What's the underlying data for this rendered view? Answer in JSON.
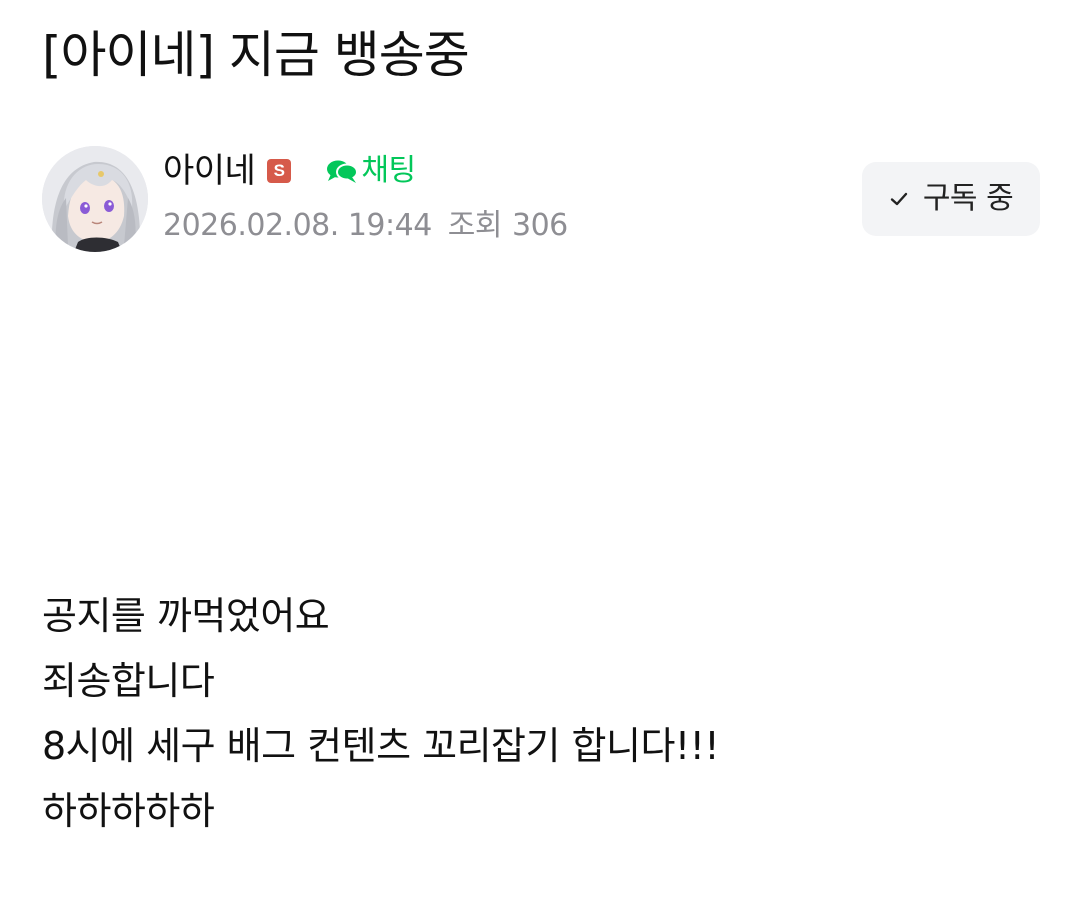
{
  "post": {
    "title": "[아이네] 지금 뱅송중",
    "author": {
      "name": "아이네",
      "badge": "S",
      "badge_color": "#d65a4a"
    },
    "chat": {
      "label": "채팅",
      "icon": "speech-bubbles-icon",
      "color": "#03c75a"
    },
    "meta": {
      "date": "2026.02.08. 19:44",
      "views_label": "조회",
      "views_count": "306"
    },
    "subscribe": {
      "icon": "check-icon",
      "label": "구독 중"
    },
    "body": {
      "lines": [
        "공지를 까먹었어요",
        "죄송합니다",
        "8시에 세구 배그 컨텐츠 꼬리잡기 합니다!!!",
        "하하하하하"
      ]
    }
  }
}
